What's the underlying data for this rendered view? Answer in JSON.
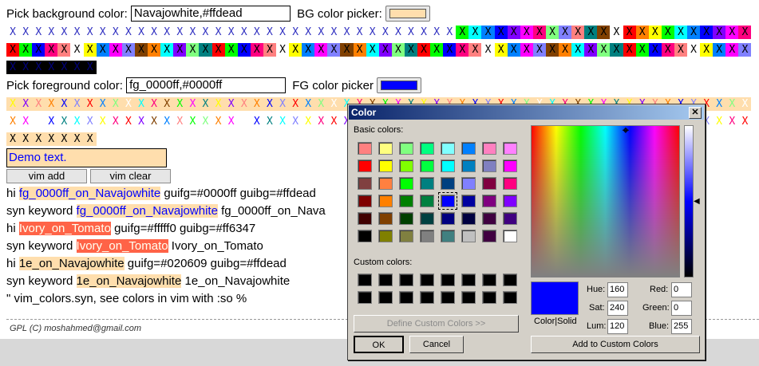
{
  "bg": {
    "label": "Pick background color:",
    "value": "Navajowhite,#ffdead",
    "picker_label": "BG color picker:",
    "picker_color": "#ffdead"
  },
  "fg": {
    "label": "Pick foreground color:",
    "value": "fg_0000ff,#0000ff",
    "picker_label": "FG color picker",
    "picker_color": "#0000ff"
  },
  "x_char": "X",
  "demo_text": "Demo text.",
  "buttons": {
    "add": "vim add",
    "clear": "vim clear"
  },
  "code": [
    {
      "prefix": "hi ",
      "hl": "fg_0000ff_on_Navajowhite",
      "suffix": " guifg=#0000ff guibg=#ffdead"
    },
    {
      "prefix": "syn keyword ",
      "hl": "fg_0000ff_on_Navajowhite",
      "suffix": " fg_0000ff_on_Nava"
    },
    {
      "prefix": "hi ",
      "hl": "Ivory_on_Tomato",
      "suffix": " guifg=#fffff0 guibg=#ff6347"
    },
    {
      "prefix": "syn keyword ",
      "hl": "Ivory_on_Tomato",
      "suffix": " Ivory_on_Tomato"
    },
    {
      "prefix": "hi ",
      "hl": "1e_on_Navajowhite",
      "suffix": " guifg=#020609 guibg=#ffdead"
    },
    {
      "prefix": "syn keyword ",
      "hl": "1e_on_Navajowhite",
      "suffix": " 1e_on_Navajowhite"
    },
    {
      "prefix": "\" vim_colors.syn, see colors in vim with :so %",
      "hl": "",
      "suffix": ""
    }
  ],
  "footer": "GPL (C) moshahmed@gmail.com",
  "dialog": {
    "title": "Color",
    "close": "✕",
    "basic_label": "Basic colors:",
    "custom_label": "Custom colors:",
    "define_btn": "Define Custom Colors >>",
    "ok": "OK",
    "cancel": "Cancel",
    "color_solid": "Color|Solid",
    "add_custom": "Add to Custom Colors",
    "hue_label": "Hue:",
    "hue": "160",
    "sat_label": "Sat:",
    "sat": "240",
    "lum_label": "Lum:",
    "lum": "120",
    "red_label": "Red:",
    "red": "0",
    "green_label": "Green:",
    "green": "0",
    "blue_label": "Blue:",
    "blue": "255",
    "current_color": "#0000ff",
    "basic_colors": [
      "#ff8080",
      "#ffff80",
      "#80ff80",
      "#00ff80",
      "#80ffff",
      "#0080ff",
      "#ff80c0",
      "#ff80ff",
      "#ff0000",
      "#ffff00",
      "#80ff00",
      "#00ff40",
      "#00ffff",
      "#0080c0",
      "#8080c0",
      "#ff00ff",
      "#804040",
      "#ff8040",
      "#00ff00",
      "#008080",
      "#004080",
      "#8080ff",
      "#800040",
      "#ff0080",
      "#800000",
      "#ff8000",
      "#008000",
      "#008040",
      "#0000ff",
      "#0000a0",
      "#800080",
      "#8000ff",
      "#400000",
      "#804000",
      "#004000",
      "#004040",
      "#000080",
      "#000040",
      "#400040",
      "#400080",
      "#000000",
      "#808000",
      "#808040",
      "#808080",
      "#408080",
      "#c0c0c0",
      "#400040",
      "#ffffff"
    ],
    "selected_index": 28
  }
}
